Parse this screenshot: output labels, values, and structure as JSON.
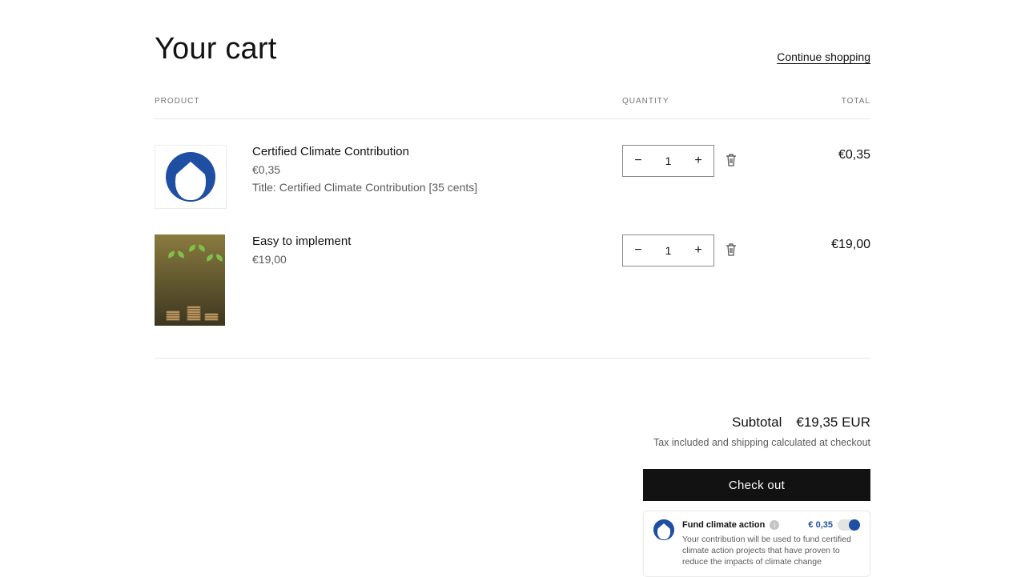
{
  "header": {
    "title": "Your cart",
    "continue": "Continue shopping"
  },
  "columns": {
    "product": "PRODUCT",
    "quantity": "QUANTITY",
    "total": "TOTAL"
  },
  "items": [
    {
      "name": "Certified Climate Contribution",
      "price": "€0,35",
      "meta": "Title: Certified Climate Contribution [35 cents]",
      "qty": "1",
      "total": "€0,35",
      "thumb": "penguin"
    },
    {
      "name": "Easy to implement",
      "price": "€19,00",
      "meta": "",
      "qty": "1",
      "total": "€19,00",
      "thumb": "sprout"
    }
  ],
  "summary": {
    "subtotal_label": "Subtotal",
    "subtotal_value": "€19,35 EUR",
    "tax_note": "Tax included and shipping calculated at checkout",
    "checkout": "Check out"
  },
  "climate": {
    "title": "Fund climate action",
    "amount": "€ 0,35",
    "desc": "Your contribution will be used to fund certified climate action projects that have proven to reduce the impacts of climate change"
  }
}
